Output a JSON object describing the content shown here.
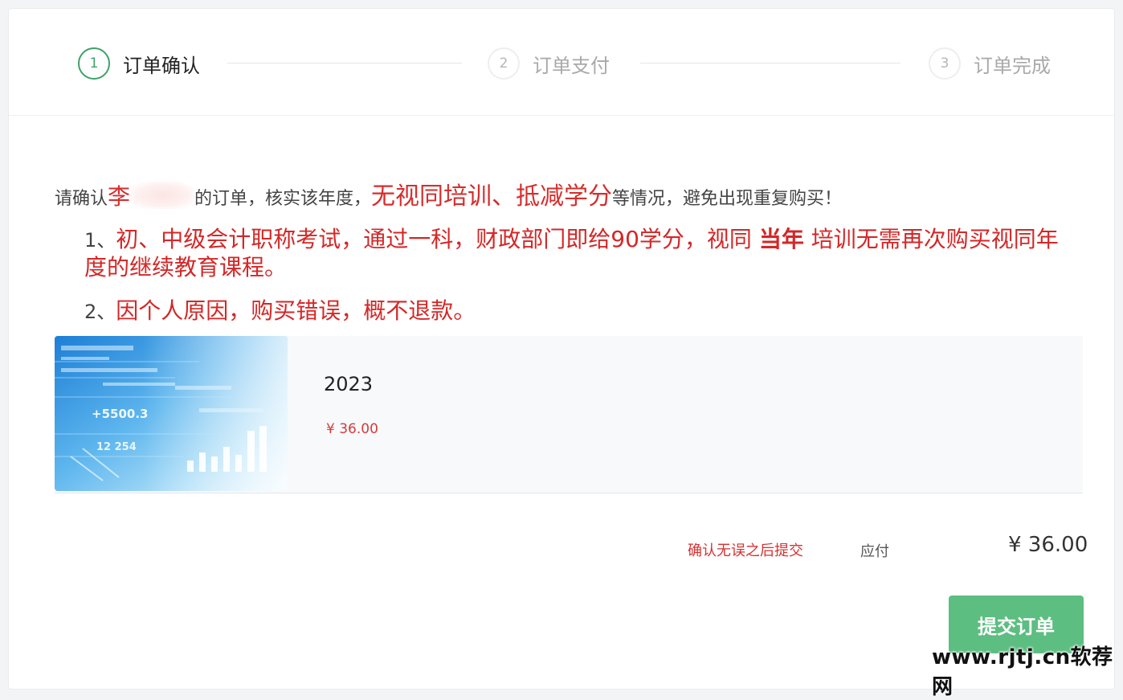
{
  "steps": [
    {
      "number": "1",
      "label": "订单确认",
      "state": "active"
    },
    {
      "number": "2",
      "label": "订单支付",
      "state": "pending"
    },
    {
      "number": "3",
      "label": "订单完成",
      "state": "pending"
    }
  ],
  "notice": {
    "prefix": "请确认",
    "name_visible": "李",
    "after_name": "的订单，核实该年度，",
    "highlight": "无视同培训、抵减学分",
    "suffix": "等情况，避免出现重复购买！",
    "item1": {
      "num": "1、",
      "part1": "初、中级会计职称考试，通过一科，财政部门即给90学分，视同",
      "bold": "当年",
      "part2": "培训无需再次购买视同年度的继续教育课程。"
    },
    "item2": {
      "num": "2、",
      "text": "因个人原因，购买错误，概不退款。"
    }
  },
  "product": {
    "title": "2023",
    "price": "¥ 36.00",
    "thumb_labels": [
      "+5500.3",
      "12 254"
    ]
  },
  "summary": {
    "hint": "确认无误之后提交",
    "label": "应付",
    "total": "¥ 36.00"
  },
  "submit_label": "提交订单",
  "watermark": "www.rjtj.cn软荐网",
  "colors": {
    "accent_green": "#3fa06a",
    "button_green": "#5cbe80",
    "warning_red": "#d42727"
  }
}
